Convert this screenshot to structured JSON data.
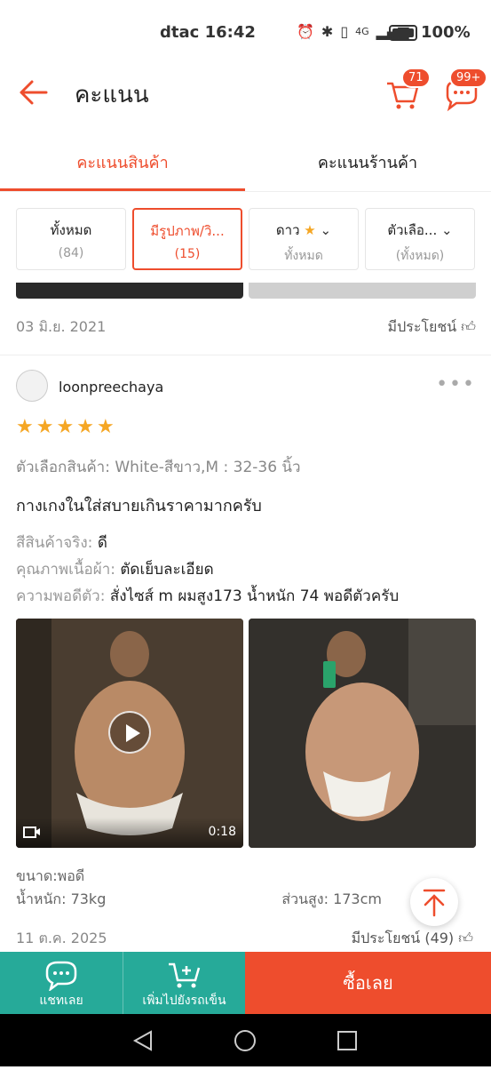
{
  "status": {
    "carrier": "dtac",
    "time": "16:42",
    "network": "4G",
    "battery": "100%"
  },
  "header": {
    "title": "คะแนน",
    "cart_badge": "71",
    "chat_badge": "99+"
  },
  "tabs": [
    {
      "label": "คะแนนสินค้า",
      "active": true
    },
    {
      "label": "คะแนนร้านค้า",
      "active": false
    }
  ],
  "filters": [
    {
      "label": "ทั้งหมด",
      "sub": "(84)",
      "active": false
    },
    {
      "label": "มีรูปภาพ/วิ...",
      "sub": "(15)",
      "active": true
    },
    {
      "label": "ดาว",
      "sub": "ทั้งหมด",
      "active": false
    },
    {
      "label": "ตัวเลือ...",
      "sub": "(ทั้งหมด)",
      "active": false
    }
  ],
  "prev_review": {
    "date": "03 มิ.ย. 2021",
    "useful": "มีประโยชน์"
  },
  "review": {
    "username": "loonpreechaya",
    "stars": 5,
    "variant": "ตัวเลือกสินค้า: White-สีขาว,M : 32-36 นิ้ว",
    "comment": "กางเกงในใส่สบายเกินราคามากครับ",
    "attributes": [
      {
        "key": "สีสินค้าจริง: ",
        "value": "ดี"
      },
      {
        "key": "คุณภาพเนื้อผ้า: ",
        "value": "ตัดเย็บละเอียด"
      },
      {
        "key": "ความพอดีตัว: ",
        "value": "สั่งไซส์ m ผมสูง173 น้ำหนัก 74 พอดีตัวครับ"
      }
    ],
    "video_duration": "0:18",
    "size": "ขนาด:พอดี",
    "weight": "น้ำหนัก: 73kg",
    "height": "ส่วนสูง: 173cm",
    "date": "11 ต.ค. 2025",
    "useful": "มีประโยชน์ (49)"
  },
  "bottom": {
    "chat": "แชทเลย",
    "add_cart": "เพิ่มไปยังรถเข็น",
    "buy": "ซื้อเลย"
  },
  "colors": {
    "accent": "#ee4d2d",
    "teal": "#26aa99",
    "star": "#f5a623"
  }
}
